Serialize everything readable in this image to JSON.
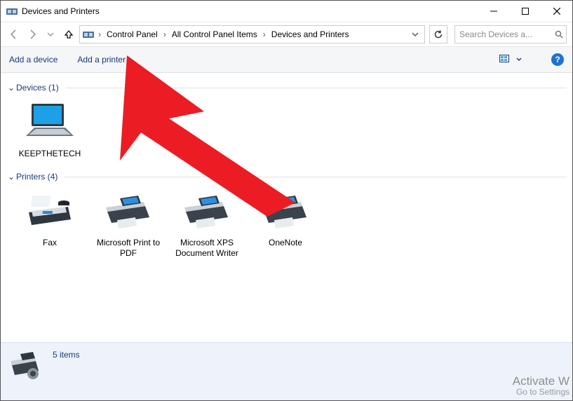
{
  "window": {
    "title": "Devices and Printers"
  },
  "breadcrumb": {
    "items": [
      "Control Panel",
      "All Control Panel Items",
      "Devices and Printers"
    ]
  },
  "search": {
    "placeholder": "Search Devices a..."
  },
  "commands": {
    "add_device": "Add a device",
    "add_printer": "Add a printer"
  },
  "groups": [
    {
      "label": "Devices",
      "count": 1,
      "items": [
        {
          "name": "KEEPTHETECH",
          "icon": "laptop"
        }
      ]
    },
    {
      "label": "Printers",
      "count": 4,
      "items": [
        {
          "name": "Fax",
          "icon": "fax"
        },
        {
          "name": "Microsoft Print to PDF",
          "icon": "printer"
        },
        {
          "name": "Microsoft XPS Document Writer",
          "icon": "printer"
        },
        {
          "name": "OneNote",
          "icon": "printer"
        }
      ]
    }
  ],
  "status": {
    "items_text": "5 items"
  },
  "watermark": {
    "line1": "Activate W",
    "line2": "Go to Settings"
  },
  "help_glyph": "?"
}
